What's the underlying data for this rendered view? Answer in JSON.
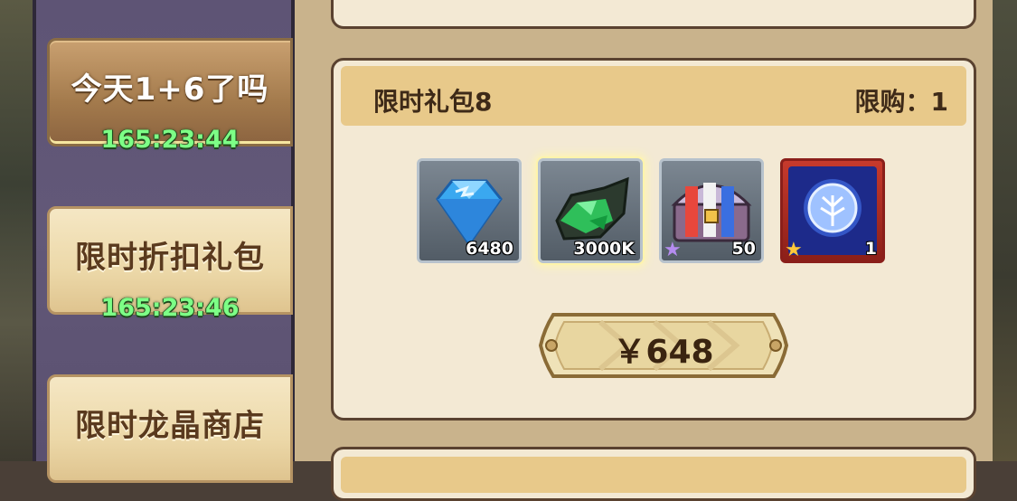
{
  "sidebar": {
    "tabs": [
      {
        "label": "今天1+6了吗",
        "timer": "165:23:44",
        "active": true
      },
      {
        "label": "限时折扣礼包",
        "timer": "165:23:46",
        "active": false
      },
      {
        "label": "限时龙晶商店",
        "timer": "",
        "active": false
      }
    ]
  },
  "pack": {
    "title": "限时礼包8",
    "limit": "限购：1",
    "items": [
      {
        "icon": "blue-diamond-icon",
        "quantity": "6480"
      },
      {
        "icon": "green-ore-icon",
        "quantity": "3000K"
      },
      {
        "icon": "treasure-chest-icon",
        "quantity": "50",
        "star": "purple"
      },
      {
        "icon": "spirit-orb-icon",
        "quantity": "1",
        "star": "gold"
      }
    ],
    "price": "￥648"
  },
  "colors": {
    "timer": "#7dff86",
    "card_bg": "#f3e9d4",
    "header_bar": "#e8c98a",
    "sidebar": "#5e5475"
  }
}
